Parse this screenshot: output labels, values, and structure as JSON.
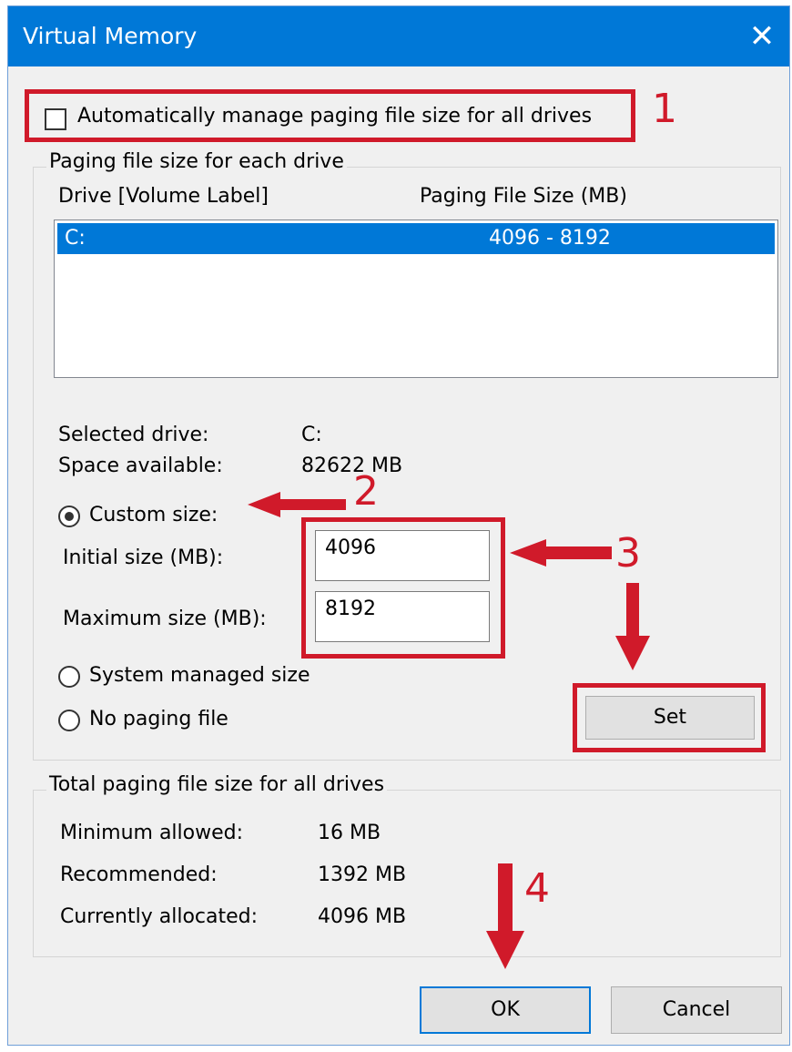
{
  "window": {
    "title": "Virtual Memory",
    "close_glyph": "✕"
  },
  "auto_manage": {
    "label": "Automatically manage paging file size for all drives",
    "checked": false
  },
  "paging_group": {
    "title": "Paging file size for each drive",
    "col_drive": "Drive  [Volume Label]",
    "col_size": "Paging File Size (MB)",
    "rows": [
      {
        "drive": "C:",
        "size": "4096 - 8192",
        "selected": true
      }
    ],
    "selected_drive_label": "Selected drive:",
    "selected_drive_value": "C:",
    "space_label": "Space available:",
    "space_value": "82622 MB",
    "custom_size": "Custom size:",
    "initial_label": "Initial size (MB):",
    "initial_value": "4096",
    "maximum_label": "Maximum size (MB):",
    "maximum_value": "8192",
    "system_managed": "System managed size",
    "no_paging": "No paging file",
    "set_button": "Set",
    "selected_option": "custom"
  },
  "total_group": {
    "title": "Total paging file size for all drives",
    "min_label": "Minimum allowed:",
    "min_value": "16 MB",
    "rec_label": "Recommended:",
    "rec_value": "1392 MB",
    "cur_label": "Currently allocated:",
    "cur_value": "4096 MB"
  },
  "buttons": {
    "ok": "OK",
    "cancel": "Cancel"
  },
  "annotations": {
    "n1": "1",
    "n2": "2",
    "n3": "3",
    "n4": "4",
    "color": "#d01a2a"
  },
  "colors": {
    "titlebar": "#0078d7",
    "selection": "#0078d7",
    "dialog_bg": "#f0f0f0"
  }
}
